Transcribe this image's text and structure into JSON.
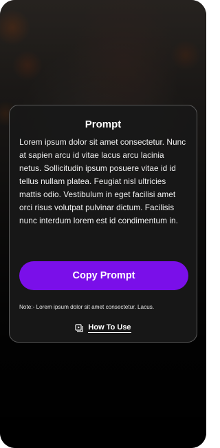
{
  "card": {
    "title": "Prompt",
    "body": "Lorem ipsum dolor sit amet consectetur. Nunc at sapien arcu id vitae lacus arcu lacinia netus. Sollicitudin ipsum posuere vitae id id tellus nullam platea. Feugiat nisl ultricies mattis odio. Vestibulum in eget facilisi amet orci risus volutpat pulvinar dictum. Facilisis nunc interdum lorem est id condimentum in.",
    "copy_button_label": "Copy Prompt",
    "note": "Note:- Lorem ipsum dolor sit amet consectetur. Lacus.",
    "how_to_use_label": "How To Use",
    "how_to_use_icon": "video-play-icon"
  },
  "colors": {
    "accent": "#7a0fe9",
    "card_bg": "#181818",
    "card_border": "#5a5a5a"
  }
}
